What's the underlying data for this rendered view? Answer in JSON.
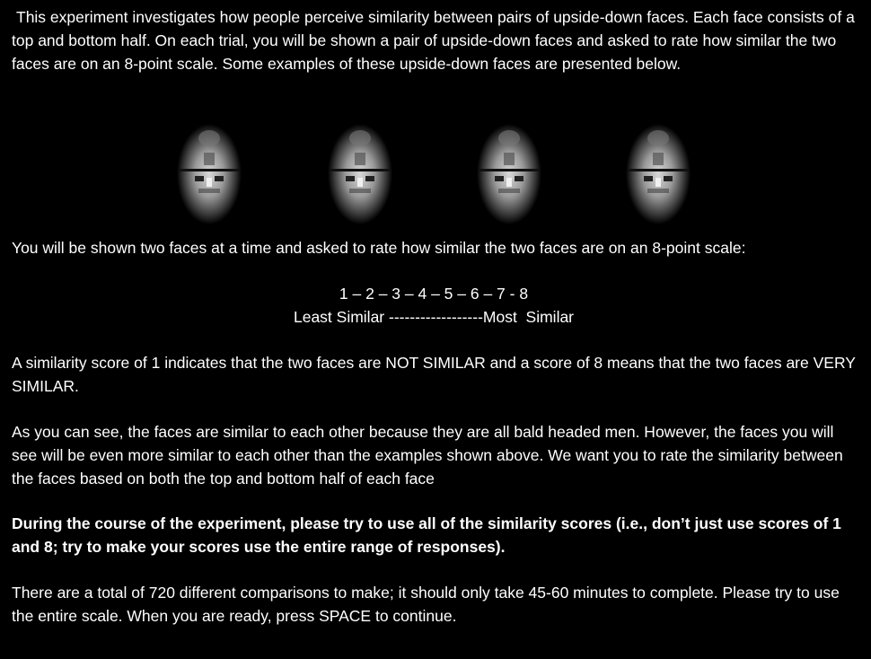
{
  "intro": "This experiment investigates how people perceive similarity between pairs of upside-down faces. Each face consists of a top and bottom half. On each trial, you will be shown a pair of upside-down faces and asked to rate how similar the two faces are on an 8-point scale. Some examples of these upside-down faces are presented below.",
  "examples": [
    {
      "icon": "inverted-face-image"
    },
    {
      "icon": "inverted-face-image"
    },
    {
      "icon": "inverted-face-image"
    },
    {
      "icon": "inverted-face-image"
    }
  ],
  "scale_intro": "You will be shown two faces at a time and asked to rate how similar the two faces are on an 8-point scale:",
  "scale": {
    "numbers": "1 – 2 – 3 – 4 – 5 – 6 – 7 - 8",
    "anchors": "Least Similar ------------------Most  Similar"
  },
  "score_explain": "A similarity score of 1 indicates that the two faces are NOT SIMILAR and a score of 8 means that the two faces are VERY SIMILAR.",
  "faces_note": "As you can see, the faces are similar to each other because they are all bald headed men. However, the faces you will see will be even more similar to each other than the examples shown above. We want you to rate the similarity between the faces based on both the top and bottom half of each face",
  "instructions_bold": "During the course of the experiment, please try to use all of the similarity scores (i.e., don’t just use scores of 1 and 8; try to make your scores use the entire range of responses).",
  "closing": "There are a total of 720 different comparisons to make; it should only take 45-60 minutes to complete. Please try to use the entire scale. When you are ready, press SPACE to continue."
}
